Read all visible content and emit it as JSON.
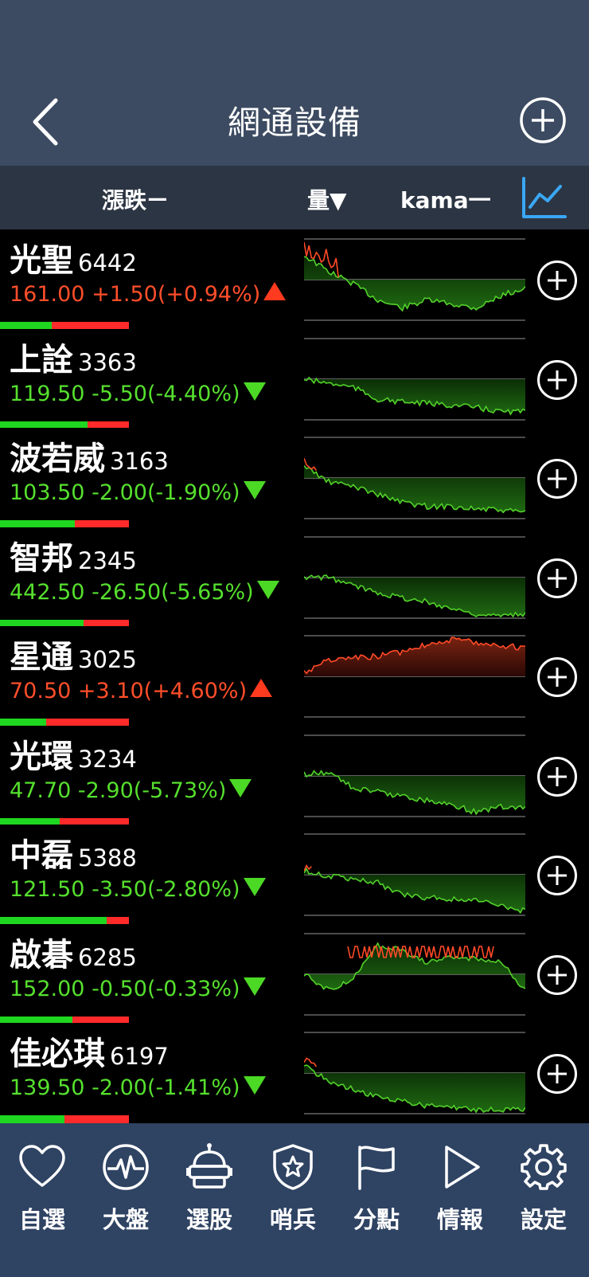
{
  "header": {
    "title": "網通設備",
    "back_icon": "chevron-left-icon",
    "add_icon": "plus-circle-icon"
  },
  "sort_bar": {
    "change_label": "漲跌ㄧ",
    "volume_label": "量▼",
    "kama_label": "kama一",
    "chart_icon": "line-chart-icon"
  },
  "colors": {
    "up": "#ff4e2a",
    "down": "#56e02e",
    "header_bg": "#3c4b61",
    "tabbar_bg": "#2f4363",
    "accent_blue": "#3aa7f5"
  },
  "stocks": [
    {
      "name": "光聖",
      "code": "6442",
      "price": "161.00",
      "change": "+1.50",
      "pct": "(+0.94%)",
      "dir": "up",
      "green_ratio": 0.4
    },
    {
      "name": "上詮",
      "code": "3363",
      "price": "119.50",
      "change": "-5.50",
      "pct": "(-4.40%)",
      "dir": "down",
      "green_ratio": 0.68
    },
    {
      "name": "波若威",
      "code": "3163",
      "price": "103.50",
      "change": "-2.00",
      "pct": "(-1.90%)",
      "dir": "down",
      "green_ratio": 0.58
    },
    {
      "name": "智邦",
      "code": "2345",
      "price": "442.50",
      "change": "-26.50",
      "pct": "(-5.65%)",
      "dir": "down",
      "green_ratio": 0.65
    },
    {
      "name": "星通",
      "code": "3025",
      "price": "70.50",
      "change": "+3.10",
      "pct": "(+4.60%)",
      "dir": "up",
      "green_ratio": 0.36
    },
    {
      "name": "光環",
      "code": "3234",
      "price": "47.70",
      "change": "-2.90",
      "pct": "(-5.73%)",
      "dir": "down",
      "green_ratio": 0.46
    },
    {
      "name": "中磊",
      "code": "5388",
      "price": "121.50",
      "change": "-3.50",
      "pct": "(-2.80%)",
      "dir": "down",
      "green_ratio": 0.83
    },
    {
      "name": "啟碁",
      "code": "6285",
      "price": "152.00",
      "change": "-0.50",
      "pct": "(-0.33%)",
      "dir": "down",
      "green_ratio": 0.56
    },
    {
      "name": "佳必琪",
      "code": "6197",
      "price": "139.50",
      "change": "-2.00",
      "pct": "(-1.41%)",
      "dir": "down",
      "green_ratio": 0.5
    }
  ],
  "tabs": [
    {
      "label": "自選",
      "icon": "heart-icon"
    },
    {
      "label": "大盤",
      "icon": "pulse-icon"
    },
    {
      "label": "選股",
      "icon": "robot-icon"
    },
    {
      "label": "哨兵",
      "icon": "shield-star-icon"
    },
    {
      "label": "分點",
      "icon": "flag-icon"
    },
    {
      "label": "情報",
      "icon": "play-icon"
    },
    {
      "label": "設定",
      "icon": "gear-icon"
    }
  ]
}
